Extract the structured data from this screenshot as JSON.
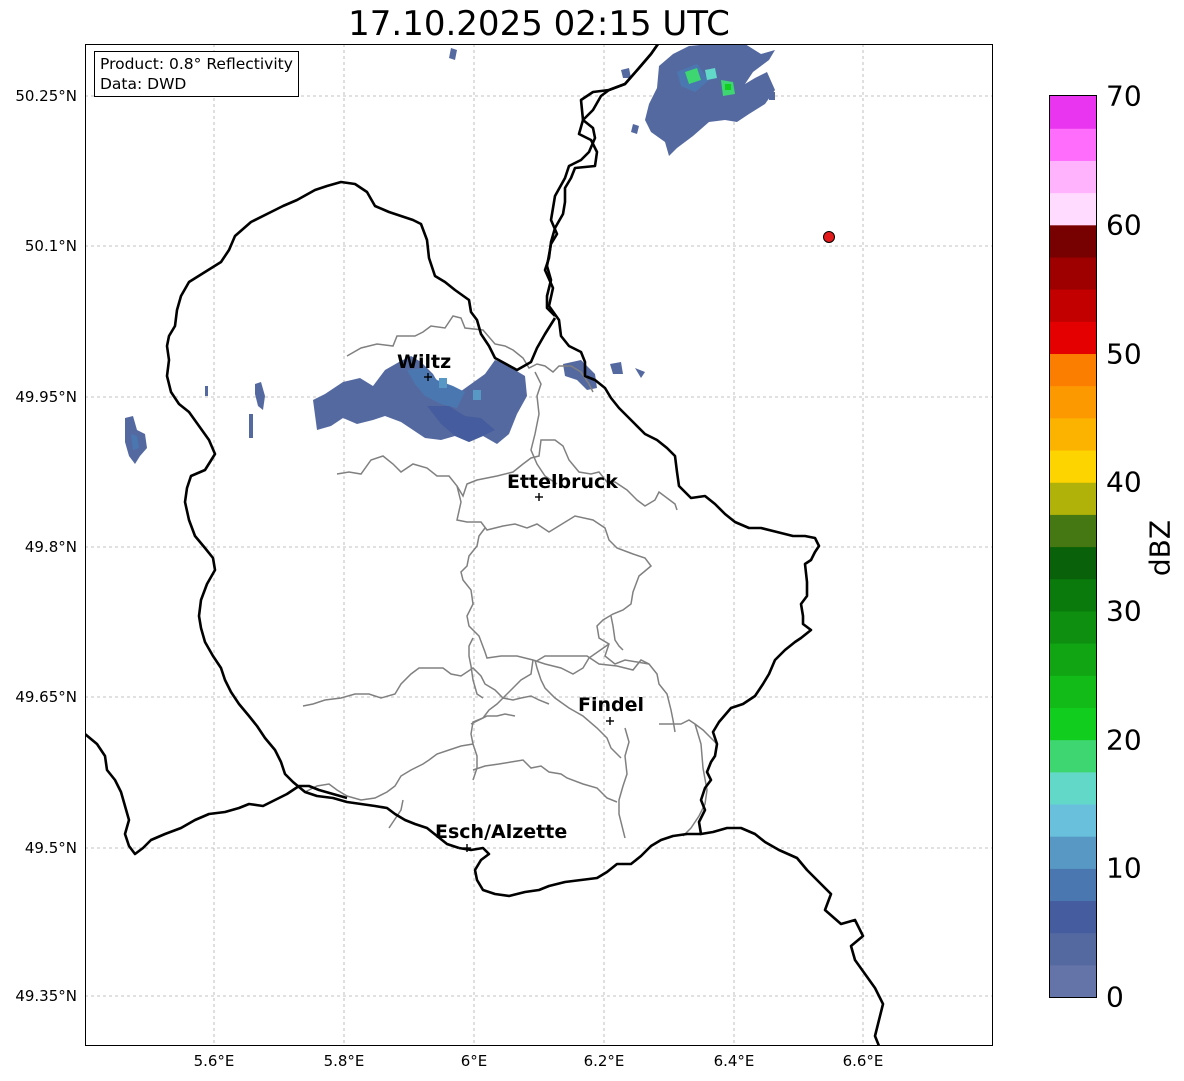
{
  "title": "17.10.2025 02:15 UTC",
  "info": {
    "product": "Product: 0.8° Reflectivity",
    "data": "Data: DWD"
  },
  "lat_labels": [
    "50.25°N",
    "50.1°N",
    "49.95°N",
    "49.8°N",
    "49.65°N",
    "49.5°N",
    "49.35°N"
  ],
  "lon_labels": [
    "5.6°E",
    "5.8°E",
    "6°E",
    "6.2°E",
    "6.4°E",
    "6.6°E"
  ],
  "cities": [
    {
      "name": "Wiltz"
    },
    {
      "name": "Ettelbruck"
    },
    {
      "name": "Findel"
    },
    {
      "name": "Esch/Alzette"
    }
  ],
  "colorbar": {
    "label": "dBZ",
    "ticks": [
      "0",
      "10",
      "20",
      "30",
      "40",
      "50",
      "60",
      "70"
    ],
    "colors": [
      "#6574a8",
      "#5569a1",
      "#455d9e",
      "#4b77b1",
      "#5898c4",
      "#68c0dc",
      "#62d8c8",
      "#3ed671",
      "#11cd1d",
      "#12bb17",
      "#11a513",
      "#0e8f10",
      "#0b7a0c",
      "#09620a",
      "#457712",
      "#b0b109",
      "#fed400",
      "#fcb300",
      "#fc9900",
      "#fc7e00",
      "#e40000",
      "#c20000",
      "#9e0000",
      "#770000",
      "#ffdbff",
      "#ffb3fd",
      "#fe6dfb",
      "#e935ef"
    ]
  },
  "colors": {
    "country_border": "#000000",
    "canton_border": "#808080",
    "grid": "#b0b0b0",
    "marker": "#e31a1c"
  }
}
